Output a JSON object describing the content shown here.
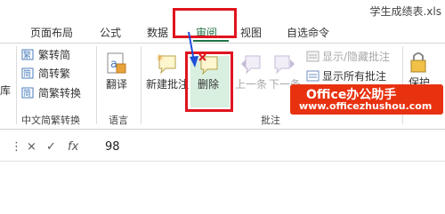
{
  "window": {
    "title": "学生成绩表.xls"
  },
  "tabs": [
    {
      "label": "页面布局"
    },
    {
      "label": "公式"
    },
    {
      "label": "数据"
    },
    {
      "label": "审阅"
    },
    {
      "label": "视图"
    },
    {
      "label": "自选命令"
    }
  ],
  "ribbon": {
    "left_partial": {
      "label": "库"
    },
    "chinese_conversion": {
      "to_traditional": "繁转简",
      "to_simplified": "简转繁",
      "convert": "简繁转换",
      "group_label": "中文简繁转换"
    },
    "language": {
      "translate": "翻译",
      "group_label": "语言"
    },
    "comments": {
      "new": "新建批注",
      "delete": "删除",
      "prev": "上一条",
      "next": "下一条",
      "show_hide": "显示/隐藏批注",
      "show_all": "显示所有批注",
      "group_label": "批注"
    },
    "protect": {
      "label": "保护"
    }
  },
  "watermark": {
    "title": "Office办公助手",
    "url": "www.officezhushou.com"
  },
  "formula_bar": {
    "cancel_icon": "×",
    "enter_icon": "✓",
    "function_icon": "fx",
    "value": "98"
  }
}
